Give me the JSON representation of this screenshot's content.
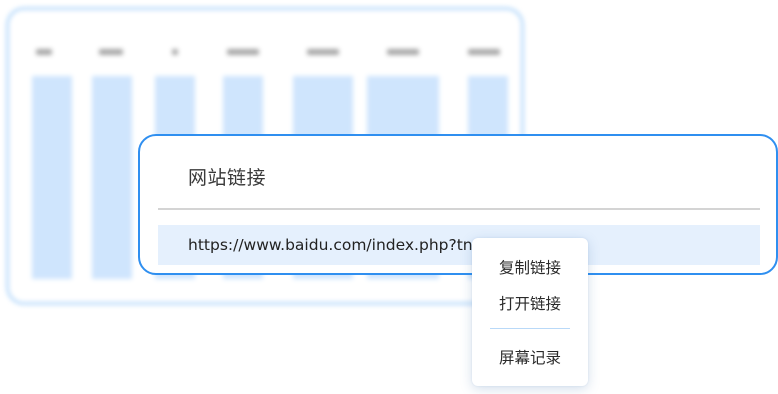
{
  "link_card": {
    "title": "网站链接",
    "url": "https://www.baidu.com/index.php?tn=68                  n_dg"
  },
  "context_menu": {
    "items": [
      {
        "label": "复制链接"
      },
      {
        "label": "打开链接"
      },
      {
        "label": "屏幕记录"
      }
    ]
  },
  "colors": {
    "accent": "#2f8ff0",
    "field_bg": "#e5f0fd",
    "menu_separator": "#b9d9f8",
    "bg_bar": "#cfe5fd"
  }
}
